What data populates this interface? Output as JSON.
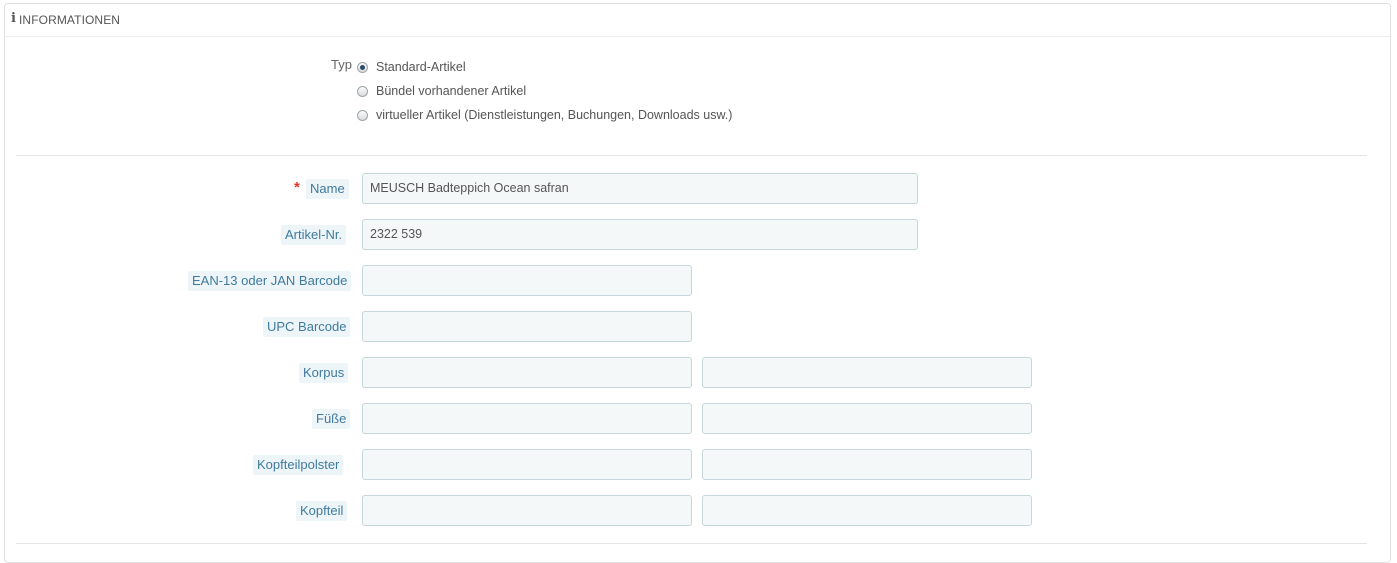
{
  "panel": {
    "title": "INFORMATIONEN",
    "icon": "info-icon"
  },
  "type_section": {
    "label": "Typ",
    "options": [
      {
        "label": "Standard-Artikel",
        "checked": true
      },
      {
        "label": "Bündel vorhandener Artikel",
        "checked": false
      },
      {
        "label": "virtueller Artikel (Dienstleistungen, Buchungen, Downloads usw.)",
        "checked": false
      }
    ]
  },
  "fields": {
    "name": {
      "label": "Name",
      "required": true,
      "value": "MEUSCH Badteppich Ocean safran"
    },
    "reference": {
      "label": "Artikel-Nr.",
      "value": "2322 539"
    },
    "ean13": {
      "label": "EAN-13 oder JAN Barcode",
      "value": ""
    },
    "upc": {
      "label": "UPC Barcode",
      "value": ""
    },
    "korpus": {
      "label": "Korpus",
      "value1": "",
      "value2": ""
    },
    "fuesse": {
      "label": "Füße",
      "value1": "",
      "value2": ""
    },
    "kopfteilpolster": {
      "label": "Kopfteilpolster",
      "value1": "",
      "value2": ""
    },
    "kopfteil": {
      "label": "Kopfteil",
      "value1": "",
      "value2": ""
    }
  },
  "colors": {
    "label_text": "#3f7a9c",
    "label_bg": "#eef5f9",
    "required": "#e0352b",
    "input_border": "#c7d6db",
    "input_bg": "#f5f8f9"
  }
}
